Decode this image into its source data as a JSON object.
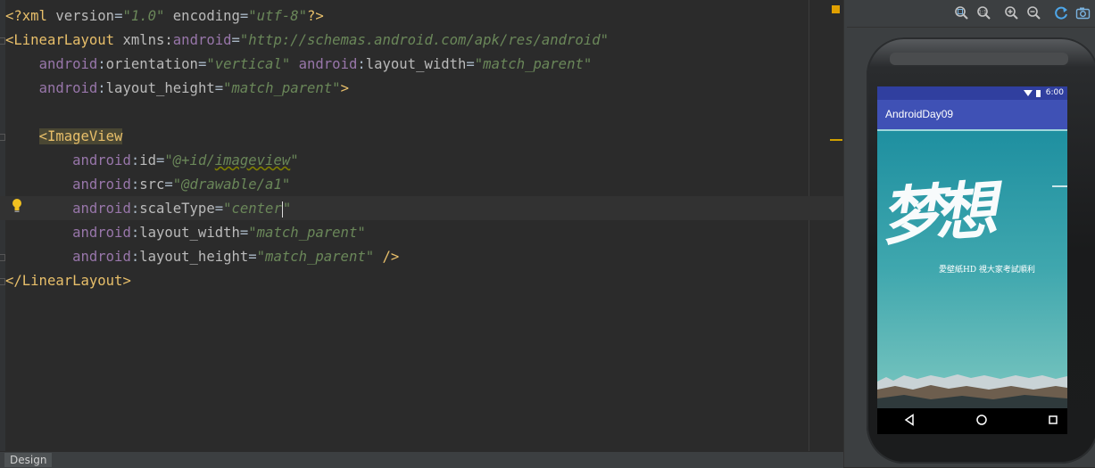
{
  "editor": {
    "lines": {
      "l1": {
        "open": "<?xml ",
        "k1": "version",
        "eq1": "=",
        "v1": "\"1.0\"",
        "sp": " ",
        "k2": "encoding",
        "eq2": "=",
        "v2": "\"utf-8\"",
        "close": "?>"
      },
      "l2": {
        "lt": "<",
        "tag": "LinearLayout",
        "sp": " ",
        "ns_attr": "xmlns:",
        "ns_name": "android",
        "eq": "=",
        "val": "\"http://schemas.android.com/apk/res/android\""
      },
      "l3": {
        "indent": "    ",
        "ns1": "android",
        "c1": ":",
        "a1": "orientation",
        "eq1": "=",
        "v1": "\"vertical\"",
        "sp": " ",
        "ns2": "android",
        "c2": ":",
        "a2": "layout_width",
        "eq2": "=",
        "v2": "\"match_parent\""
      },
      "l4": {
        "indent": "    ",
        "ns": "android",
        "c": ":",
        "a": "layout_height",
        "eq": "=",
        "v": "\"match_parent\"",
        "close": ">"
      },
      "l6": {
        "indent": "    ",
        "lt": "<",
        "tag": "ImageView"
      },
      "l7": {
        "indent": "        ",
        "ns": "android",
        "c": ":",
        "a": "id",
        "eq": "=",
        "v_open": "\"@+id/",
        "v_id": "imageview",
        "v_close": "\""
      },
      "l8": {
        "indent": "        ",
        "ns": "android",
        "c": ":",
        "a": "src",
        "eq": "=",
        "v": "\"@drawable/a1\""
      },
      "l9": {
        "indent": "        ",
        "ns": "android",
        "c": ":",
        "a": "scaleType",
        "eq": "=",
        "v_before_caret": "\"center",
        "v_after_caret": "\""
      },
      "l10": {
        "indent": "        ",
        "ns": "android",
        "c": ":",
        "a": "layout_width",
        "eq": "=",
        "v": "\"match_parent\""
      },
      "l11": {
        "indent": "        ",
        "ns": "android",
        "c": ":",
        "a": "layout_height",
        "eq": "=",
        "v": "\"match_parent\"",
        "close": " />"
      },
      "l12": {
        "open": "</",
        "tag": "LinearLayout",
        "close": ">"
      }
    },
    "bottom_tab": "Design"
  },
  "preview": {
    "status_time": "6:00",
    "app_title": "AndroidDay09",
    "image_caption": "愛壁紙HD 視大家考試順利",
    "image_title": "梦想",
    "toolbar_icons": [
      "zoom-fit-icon",
      "zoom-actual-icon",
      "zoom-in-icon",
      "zoom-out-icon",
      "refresh-icon",
      "screenshot-icon"
    ],
    "nav_icons": [
      "back-icon",
      "home-icon",
      "recents-icon"
    ]
  },
  "colors": {
    "editor_bg": "#2b2b2b",
    "tag": "#e8bf6a",
    "attr_ns": "#9876aa",
    "string": "#6a8759",
    "app_bar": "#3f51b5",
    "status_bar": "#303f9f"
  }
}
